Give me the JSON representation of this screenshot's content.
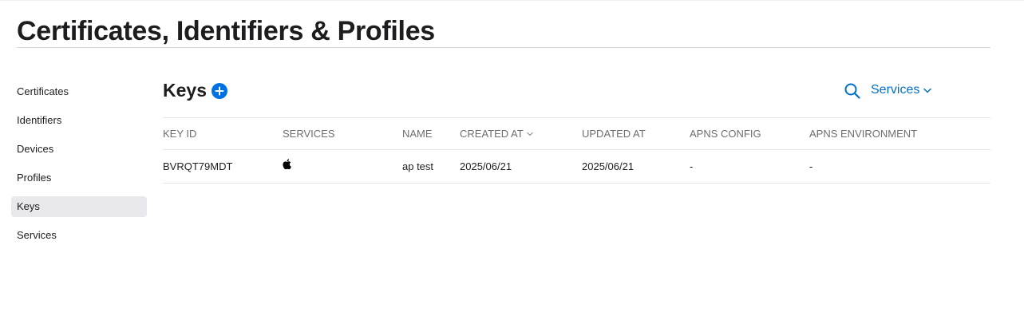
{
  "header": {
    "title": "Certificates, Identifiers & Profiles"
  },
  "sidebar": {
    "items": [
      {
        "label": "Certificates"
      },
      {
        "label": "Identifiers"
      },
      {
        "label": "Devices"
      },
      {
        "label": "Profiles"
      },
      {
        "label": "Keys",
        "active": true
      },
      {
        "label": "Services"
      }
    ]
  },
  "main": {
    "section_title": "Keys",
    "add_icon": "plus-circle-icon",
    "search_icon": "search-icon",
    "filter_label": "Services",
    "filter_icon": "chevron-down-icon",
    "sort_icon": "chevron-down-icon",
    "table": {
      "columns": [
        "KEY ID",
        "SERVICES",
        "NAME",
        "CREATED AT",
        "UPDATED AT",
        "APNS CONFIG",
        "APNS ENVIRONMENT"
      ],
      "sorted_column": "CREATED AT",
      "rows": [
        {
          "key_id": "BVRQT79MDT",
          "services_icon": "apple-logo-icon",
          "name": "ap test",
          "created_at": "2025/06/21",
          "updated_at": "2025/06/21",
          "apns_config": "-",
          "apns_environment": "-"
        }
      ]
    }
  },
  "colors": {
    "accent": "#0071e3",
    "link": "#0070c9",
    "text": "#1d1d1f",
    "muted": "#6e6e73",
    "active_bg": "#e8e8ed",
    "divider": "#e5e5ea"
  }
}
